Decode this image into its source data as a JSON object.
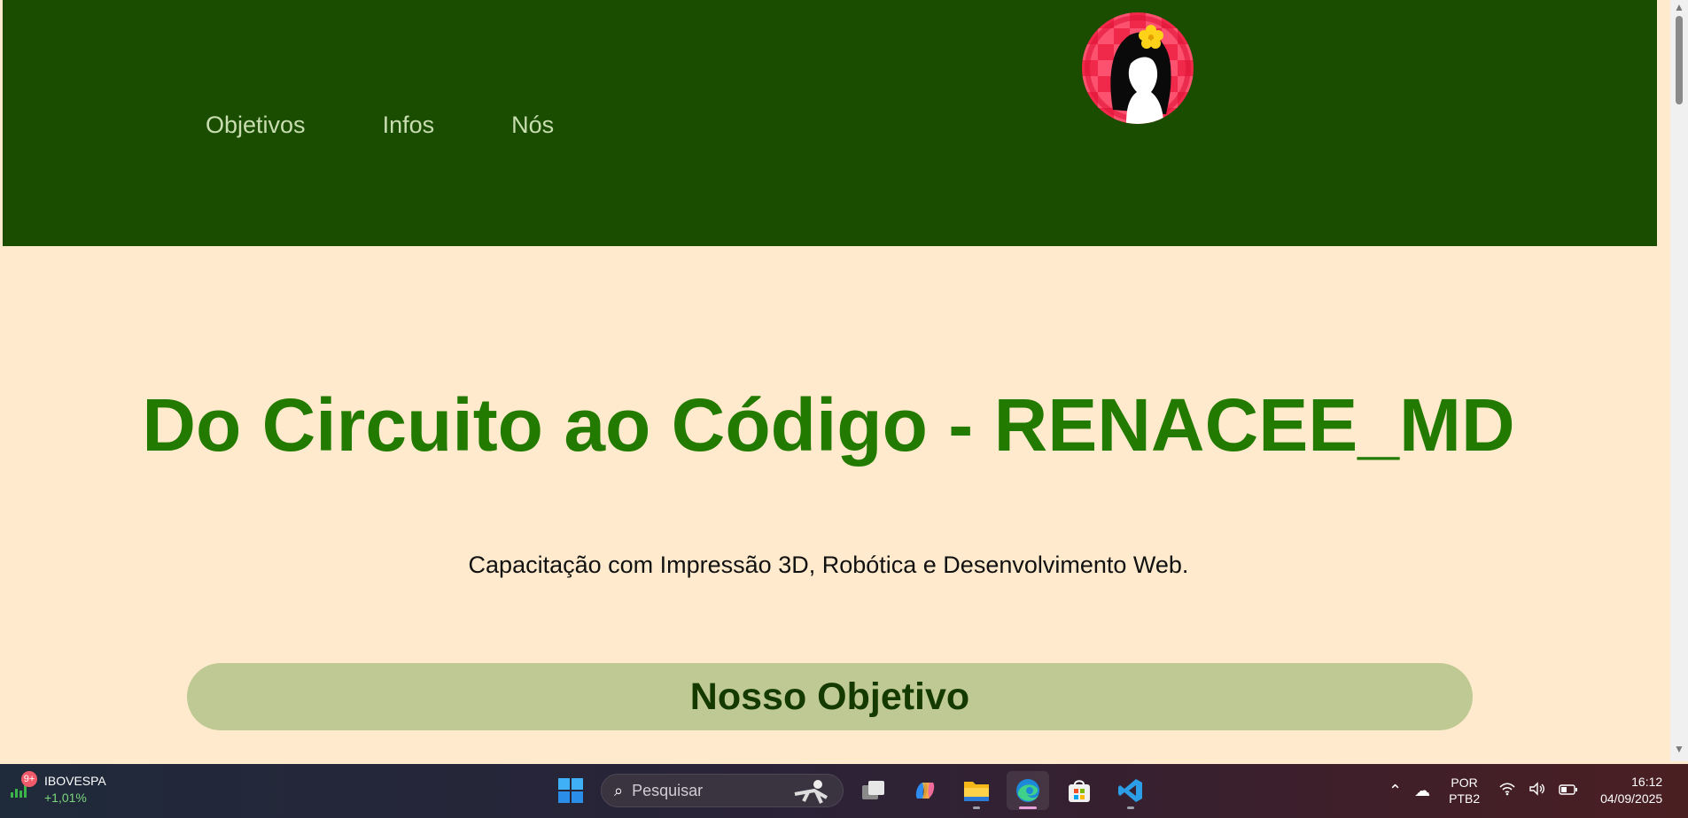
{
  "site": {
    "nav": [
      {
        "label": "Objetivos"
      },
      {
        "label": "Infos"
      },
      {
        "label": "Nós"
      }
    ],
    "hero_title": "Do Circuito ao Código - RENACEE_MD",
    "hero_subtitle": "Capacitação com Impressão 3D, Robótica e Desenvolvimento Web.",
    "section_title": "Nosso Objetivo",
    "colors": {
      "header_bg": "#1a4d00",
      "page_bg": "#ffeacd",
      "title_green": "#237a00",
      "pill_bg": "#bfc993"
    }
  },
  "taskbar": {
    "ticker_name": "IBOVESPA",
    "ticker_change": "+1,01%",
    "ticker_badge": "9+",
    "search_placeholder": "Pesquisar",
    "apps": [
      "windows-start",
      "task-view",
      "copilot",
      "file-explorer",
      "edge",
      "microsoft-store",
      "vscode"
    ],
    "lang_line1": "POR",
    "lang_line2": "PTB2",
    "time": "16:12",
    "date": "04/09/2025"
  }
}
